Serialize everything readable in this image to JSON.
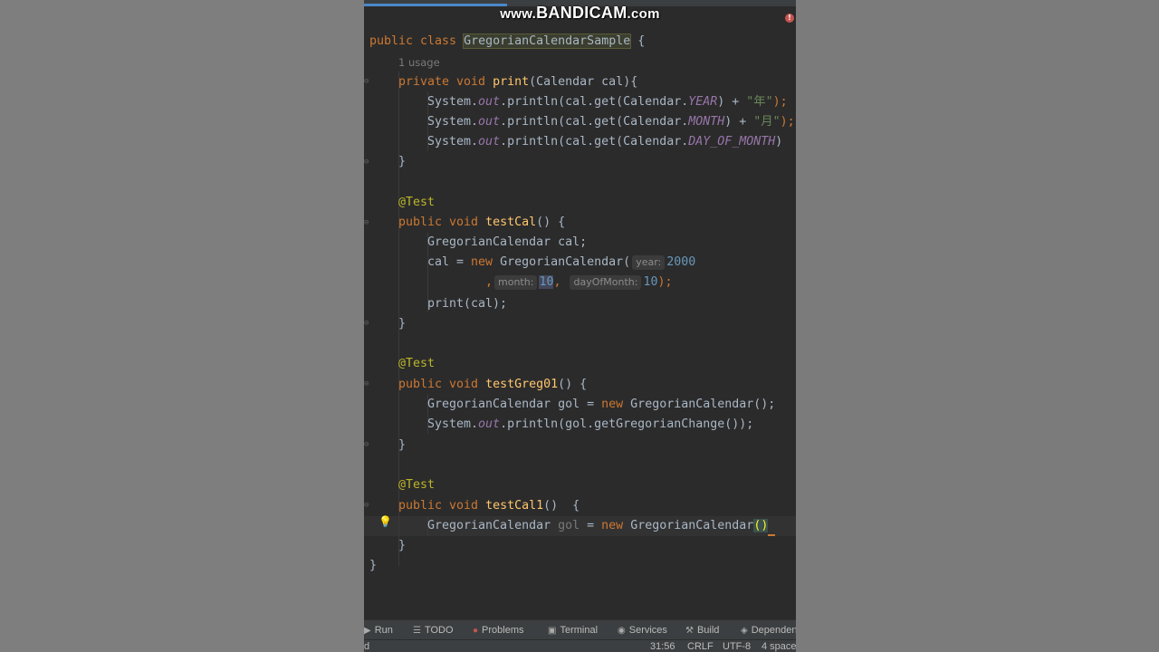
{
  "watermark": {
    "prefix": "www.",
    "brand": "BANDICAM",
    "suffix": ".com"
  },
  "editor": {
    "class_decl": {
      "kw": "public class",
      "name": "GregorianCalendarSample",
      "brace": " {"
    },
    "usage_hint": "1 usage",
    "print_method": {
      "kw": "private void",
      "name": "print",
      "params": "(Calendar cal){",
      "lines": [
        {
          "pre": "System.",
          "field": "out",
          "mid": ".println(cal.get(Calendar.",
          "const": "YEAR",
          "post": ") + ",
          "str": "\"年\"",
          "end": ");"
        },
        {
          "pre": "System.",
          "field": "out",
          "mid": ".println(cal.get(Calendar.",
          "const": "MONTH",
          "post": ") + ",
          "str": "\"月\"",
          "end": ");"
        },
        {
          "pre": "System.",
          "field": "out",
          "mid": ".println(cal.get(Calendar.",
          "const": "DAY_OF_MONTH",
          "post": ") ",
          "str": "",
          "end": ""
        }
      ]
    },
    "annotation": "@Test",
    "testCal": {
      "kw": "public void",
      "name": "testCal",
      "params": "() {",
      "decl": "GregorianCalendar cal;",
      "assign_pre": "cal = ",
      "new_kw": "new",
      "ctor": " GregorianCalendar(",
      "hint_year": "year:",
      "year": "2000",
      "comma1": ",",
      "hint_month": "month:",
      "month": "10",
      "comma2": ",",
      "hint_day": "dayOfMonth:",
      "day": "10",
      "close": ");",
      "call": "print(cal);"
    },
    "testGreg01": {
      "kw": "public void",
      "name": "testGreg01",
      "params": "() {",
      "decl_type": "GregorianCalendar gol = ",
      "new_kw": "new",
      "ctor": " GregorianCalendar();",
      "print_pre": "System.",
      "field": "out",
      "print_post": ".println(gol.getGregorianChange());"
    },
    "testCal1": {
      "kw": "public void",
      "name": "testCal1",
      "params": "()  {",
      "decl_type": "GregorianCalendar ",
      "var": "gol",
      "eq": " = ",
      "new_kw": "new",
      "ctor": " GregorianCalendar",
      "parens": "()"
    },
    "close_brace": "}"
  },
  "toolbar": {
    "run": "Run",
    "todo": "TODO",
    "problems": "Problems",
    "terminal": "Terminal",
    "services": "Services",
    "build": "Build",
    "dependencies": "Dependen"
  },
  "statusbar": {
    "left": "d",
    "position": "31:56",
    "line_sep": "CRLF",
    "encoding": "UTF-8",
    "indent": "4 space"
  }
}
